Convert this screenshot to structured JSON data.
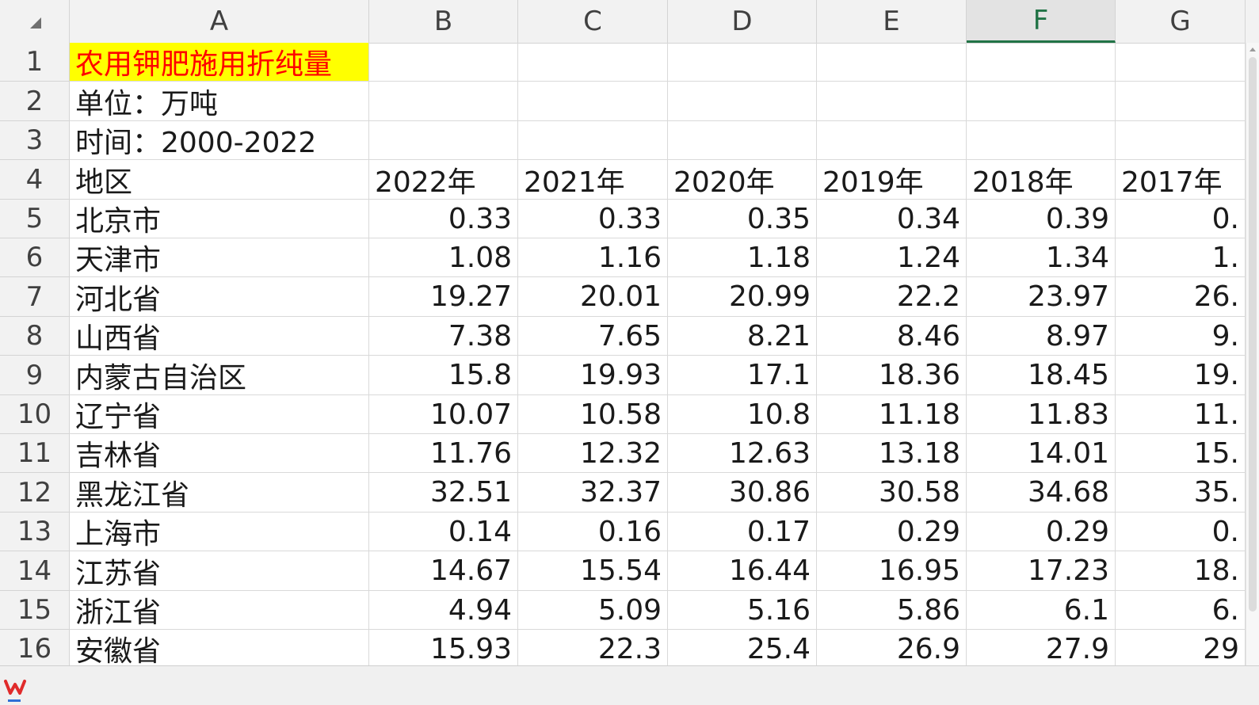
{
  "columns": [
    "A",
    "B",
    "C",
    "D",
    "E",
    "F",
    "G"
  ],
  "active_column": "F",
  "rows": [
    {
      "num": "1",
      "a": "农用钾肥施用折纯量",
      "values": [
        "",
        "",
        "",
        "",
        "",
        ""
      ]
    },
    {
      "num": "2",
      "a": "单位：万吨",
      "values": [
        "",
        "",
        "",
        "",
        "",
        ""
      ]
    },
    {
      "num": "3",
      "a": "时间：2000-2022",
      "values": [
        "",
        "",
        "",
        "",
        "",
        ""
      ]
    },
    {
      "num": "4",
      "a": "地区",
      "values": [
        "2022年",
        "2021年",
        "2020年",
        "2019年",
        "2018年",
        "2017年"
      ]
    },
    {
      "num": "5",
      "a": "北京市",
      "values": [
        "0.33",
        "0.33",
        "0.35",
        "0.34",
        "0.39",
        "0."
      ]
    },
    {
      "num": "6",
      "a": "天津市",
      "values": [
        "1.08",
        "1.16",
        "1.18",
        "1.24",
        "1.34",
        "1."
      ]
    },
    {
      "num": "7",
      "a": "河北省",
      "values": [
        "19.27",
        "20.01",
        "20.99",
        "22.2",
        "23.97",
        "26."
      ]
    },
    {
      "num": "8",
      "a": "山西省",
      "values": [
        "7.38",
        "7.65",
        "8.21",
        "8.46",
        "8.97",
        "9."
      ]
    },
    {
      "num": "9",
      "a": "内蒙古自治区",
      "values": [
        "15.8",
        "19.93",
        "17.1",
        "18.36",
        "18.45",
        "19."
      ]
    },
    {
      "num": "10",
      "a": "辽宁省",
      "values": [
        "10.07",
        "10.58",
        "10.8",
        "11.18",
        "11.83",
        "11."
      ]
    },
    {
      "num": "11",
      "a": "吉林省",
      "values": [
        "11.76",
        "12.32",
        "12.63",
        "13.18",
        "14.01",
        "15."
      ]
    },
    {
      "num": "12",
      "a": "黑龙江省",
      "values": [
        "32.51",
        "32.37",
        "30.86",
        "30.58",
        "34.68",
        "35."
      ]
    },
    {
      "num": "13",
      "a": "上海市",
      "values": [
        "0.14",
        "0.16",
        "0.17",
        "0.29",
        "0.29",
        "0."
      ]
    },
    {
      "num": "14",
      "a": "江苏省",
      "values": [
        "14.67",
        "15.54",
        "16.44",
        "16.95",
        "17.23",
        "18."
      ]
    },
    {
      "num": "15",
      "a": "浙江省",
      "values": [
        "4.94",
        "5.09",
        "5.16",
        "5.86",
        "6.1",
        "6."
      ]
    },
    {
      "num": "16",
      "a": "安徽省",
      "values": [
        "15.93",
        "22.3",
        "25.4",
        "26.9",
        "27.9",
        "29"
      ]
    }
  ],
  "colors": {
    "title_fill": "#ffff00",
    "title_text": "#ff0000",
    "active_header": "#217346"
  },
  "icons": {
    "select_all": "select-all-triangle-icon",
    "app_logo": "wps-logo-icon"
  }
}
